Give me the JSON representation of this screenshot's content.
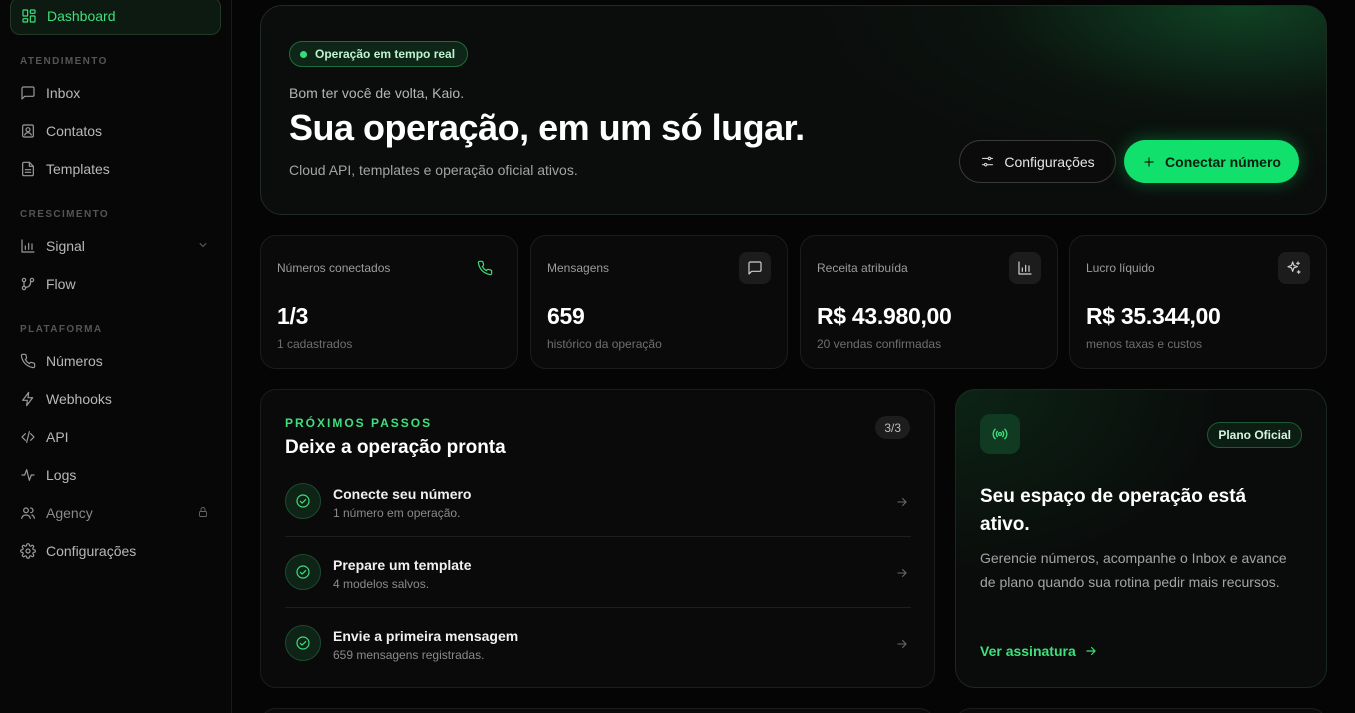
{
  "sidebar": {
    "active_item": {
      "label": "Dashboard",
      "icon": "dashboard-grid-icon"
    },
    "sections": [
      {
        "label": "ATENDIMENTO",
        "items": [
          {
            "label": "Inbox",
            "icon": "message-square-icon"
          },
          {
            "label": "Contatos",
            "icon": "contact-card-icon"
          },
          {
            "label": "Templates",
            "icon": "file-text-icon"
          }
        ]
      },
      {
        "label": "CRESCIMENTO",
        "items": [
          {
            "label": "Signal",
            "icon": "bar-chart-icon",
            "trailing": "chevron-down-icon"
          },
          {
            "label": "Flow",
            "icon": "flow-branch-icon"
          }
        ]
      },
      {
        "label": "PLATAFORMA",
        "items": [
          {
            "label": "Números",
            "icon": "phone-icon"
          },
          {
            "label": "Webhooks",
            "icon": "bolt-icon"
          },
          {
            "label": "API",
            "icon": "code-icon"
          },
          {
            "label": "Logs",
            "icon": "activity-icon"
          },
          {
            "label": "Agency",
            "icon": "users-icon",
            "trailing": "lock-icon"
          },
          {
            "label": "Configurações",
            "icon": "gear-icon"
          }
        ]
      }
    ]
  },
  "hero": {
    "badge": "Operação em tempo real",
    "greeting": "Bom ter você de volta, Kaio.",
    "title": "Sua operação, em um só lugar.",
    "subtitle": "Cloud API, templates e operação oficial ativos.",
    "settings_button": "Configurações",
    "connect_button": "Conectar número"
  },
  "stats": [
    {
      "label": "Números conectados",
      "value": "1/3",
      "sub": "1 cadastrados",
      "icon": "phone-icon"
    },
    {
      "label": "Mensagens",
      "value": "659",
      "sub": "histórico da operação",
      "icon": "message-square-icon"
    },
    {
      "label": "Receita atribuída",
      "value": "R$ 43.980,00",
      "sub": "20 vendas confirmadas",
      "icon": "bar-chart-icon"
    },
    {
      "label": "Lucro líquido",
      "value": "R$ 35.344,00",
      "sub": "menos taxas e custos",
      "icon": "sparkles-icon"
    }
  ],
  "next_steps": {
    "kicker": "PRÓXIMOS PASSOS",
    "title": "Deixe a operação pronta",
    "count": "3/3",
    "items": [
      {
        "title": "Conecte seu número",
        "sub": "1 número em operação."
      },
      {
        "title": "Prepare um template",
        "sub": "4 modelos salvos."
      },
      {
        "title": "Envie a primeira mensagem",
        "sub": "659 mensagens registradas."
      }
    ]
  },
  "plan": {
    "badge": "Plano Oficial",
    "title": "Seu espaço de operação está ativo.",
    "description": "Gerencie números, acompanhe o Inbox e avance de plano quando sua rotina pedir mais recursos.",
    "link": "Ver assinatura"
  },
  "colors": {
    "accent": "#12e06c",
    "accent_text": "#3ee07c",
    "background": "#050505"
  }
}
